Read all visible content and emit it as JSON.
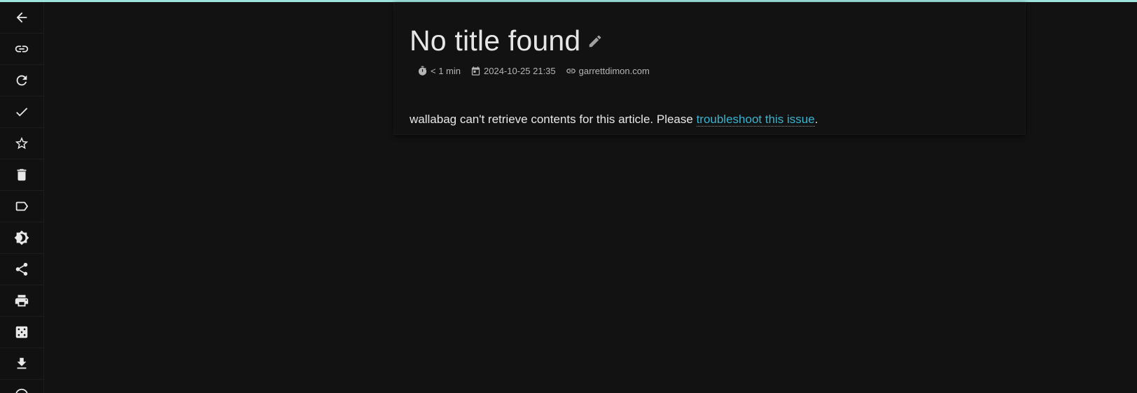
{
  "colors": {
    "background": "#121212",
    "accent_bar": "#9fe3de",
    "link": "#3ab4d0"
  },
  "sidebar": {
    "items": [
      {
        "name": "back-icon",
        "label": "Back"
      },
      {
        "name": "link-icon",
        "label": "Original link"
      },
      {
        "name": "refresh-icon",
        "label": "Reload"
      },
      {
        "name": "check-icon",
        "label": "Mark as read"
      },
      {
        "name": "star-icon",
        "label": "Favorite"
      },
      {
        "name": "trash-icon",
        "label": "Delete"
      },
      {
        "name": "tag-icon",
        "label": "Tags"
      },
      {
        "name": "brightness-icon",
        "label": "Theme"
      },
      {
        "name": "share-icon",
        "label": "Share"
      },
      {
        "name": "print-icon",
        "label": "Print"
      },
      {
        "name": "dice-icon",
        "label": "Random"
      },
      {
        "name": "download-icon",
        "label": "Export"
      }
    ]
  },
  "article": {
    "title": "No title found",
    "reading_time": "< 1 min",
    "date": "2024-10-25 21:35",
    "domain": "garrettdimon.com",
    "message_prefix": "wallabag can't retrieve contents for this article. Please ",
    "message_link": "troubleshoot this issue",
    "message_suffix": "."
  }
}
